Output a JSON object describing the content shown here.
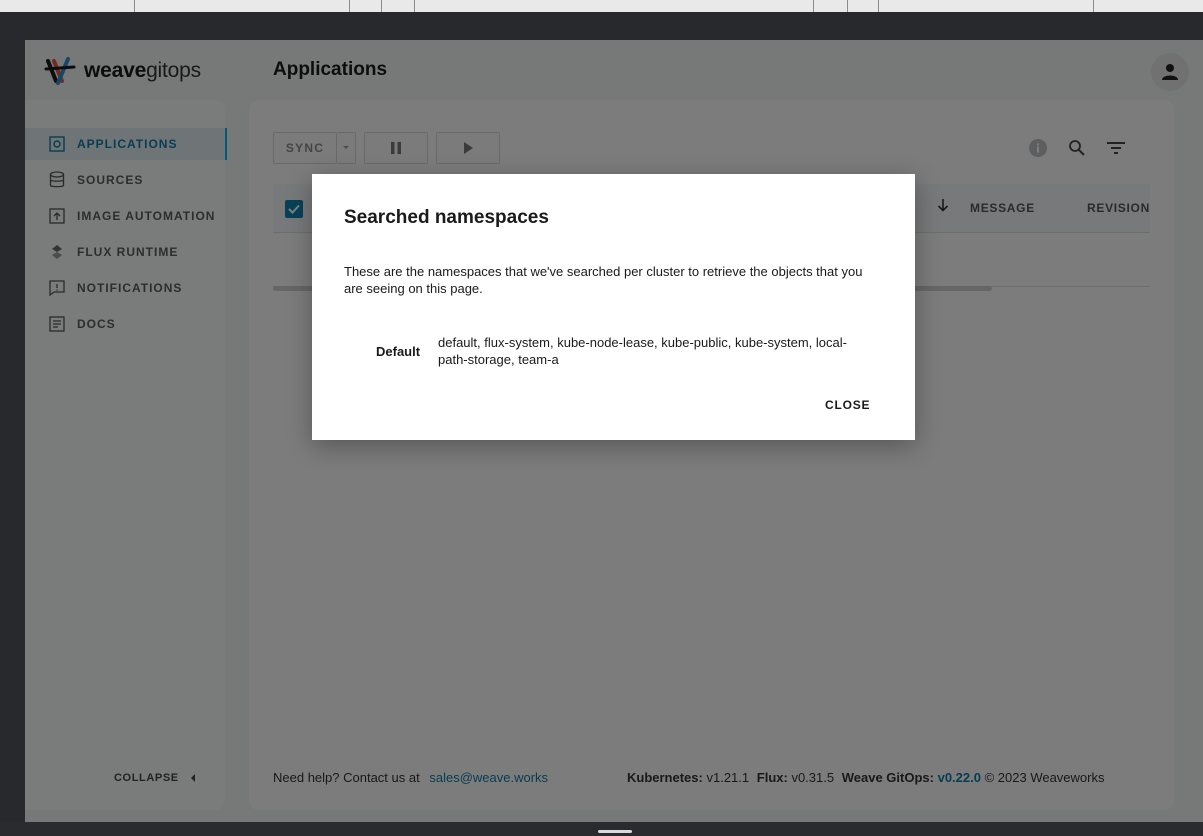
{
  "app": {
    "brand_bold": "weave",
    "brand_light": "gitops",
    "page_title": "Applications"
  },
  "sidebar": {
    "items": [
      {
        "label": "APPLICATIONS",
        "icon": "applications-icon",
        "active": true
      },
      {
        "label": "SOURCES",
        "icon": "sources-icon",
        "active": false
      },
      {
        "label": "IMAGE AUTOMATION",
        "icon": "image-automation-icon",
        "active": false
      },
      {
        "label": "FLUX RUNTIME",
        "icon": "flux-runtime-icon",
        "active": false
      },
      {
        "label": "NOTIFICATIONS",
        "icon": "notifications-icon",
        "active": false
      },
      {
        "label": "DOCS",
        "icon": "docs-icon",
        "active": false
      }
    ],
    "collapse_label": "COLLAPSE"
  },
  "toolbar": {
    "sync_label": "SYNC",
    "icons": [
      "info-icon",
      "search-icon",
      "filter-icon"
    ]
  },
  "table": {
    "select_all_checked": true,
    "columns": [
      "MESSAGE",
      "REVISION"
    ]
  },
  "footer": {
    "help_text": "Need help? Contact us at",
    "help_email": "sales@weave.works",
    "kubernetes_label": "Kubernetes:",
    "kubernetes_version": "v1.21.1",
    "flux_label": "Flux:",
    "flux_version": "v0.31.5",
    "weave_label": "Weave GitOps:",
    "weave_version": "v0.22.0",
    "copyright": "© 2023 Weaveworks"
  },
  "modal": {
    "title": "Searched namespaces",
    "description": "These are the namespaces that we've searched per cluster to retrieve the objects that you are seeing on this page.",
    "cluster_label": "Default",
    "namespaces": "default, flux-system, kube-node-lease, kube-public, kube-system, local-path-storage, team-a",
    "close_label": "CLOSE"
  },
  "colors": {
    "accent": "#0e7aa3",
    "active_border": "#00b3ec",
    "checkbox": "#0f82b0"
  }
}
